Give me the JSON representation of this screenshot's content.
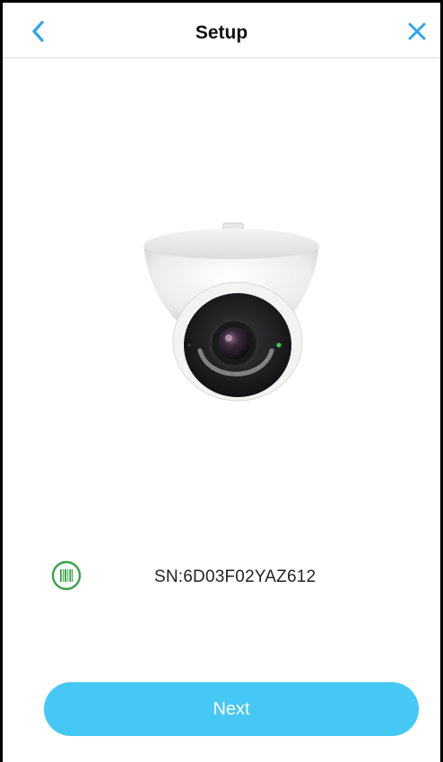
{
  "header": {
    "title": "Setup",
    "back_icon": "chevron-left-icon",
    "close_icon": "close-icon"
  },
  "device": {
    "image": "dome-camera-image",
    "serial": "SN:6D03F02YAZ612",
    "serial_icon": "barcode-icon"
  },
  "footer": {
    "next_label": "Next"
  },
  "colors": {
    "accent": "#46c8f5",
    "icon_blue": "#2ea6ee",
    "barcode_green": "#3aa24a"
  }
}
